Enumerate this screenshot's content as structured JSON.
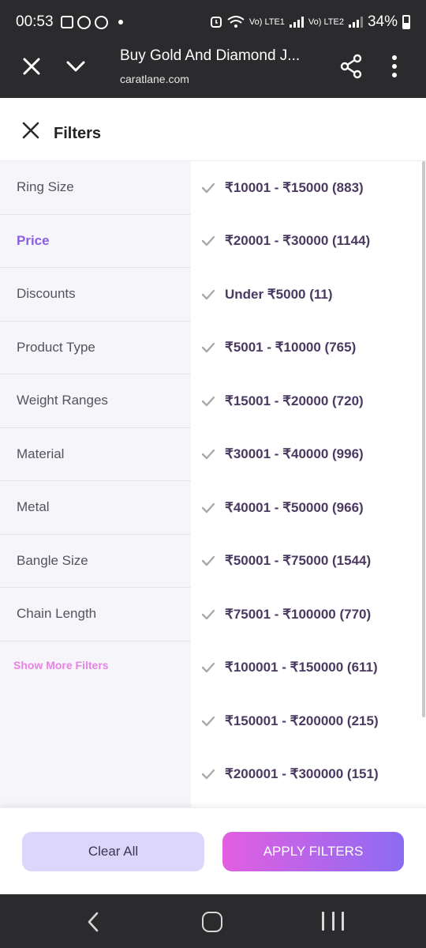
{
  "status_bar": {
    "time": "00:53",
    "network_lte1": "Vo) LTE1",
    "network_lte2": "Vo) LTE2",
    "battery": "34%",
    "icons": [
      "gallery-icon",
      "whatsapp-icon",
      "whatsapp-icon",
      "notification-dot",
      "alarm-icon",
      "wifi-icon",
      "signal-icon",
      "signal-icon",
      "battery-icon"
    ]
  },
  "browser": {
    "title": "Buy Gold And Diamond J...",
    "url": "caratlane.com",
    "icons": [
      "close-icon",
      "chevron-down-icon",
      "share-icon",
      "more-vertical-icon"
    ]
  },
  "filters": {
    "title": "Filters",
    "categories": [
      {
        "label": "Ring Size",
        "active": false
      },
      {
        "label": "Price",
        "active": true
      },
      {
        "label": "Discounts",
        "active": false
      },
      {
        "label": "Product Type",
        "active": false
      },
      {
        "label": "Weight Ranges",
        "active": false
      },
      {
        "label": "Material",
        "active": false
      },
      {
        "label": "Metal",
        "active": false
      },
      {
        "label": "Bangle Size",
        "active": false
      },
      {
        "label": "Chain Length",
        "active": false
      }
    ],
    "show_more": "Show More Filters",
    "options": [
      {
        "label": "₹10001 - ₹15000 (883)"
      },
      {
        "label": "₹20001 - ₹30000 (1144)"
      },
      {
        "label": "Under ₹5000 (11)"
      },
      {
        "label": "₹5001 - ₹10000 (765)"
      },
      {
        "label": "₹15001 - ₹20000 (720)"
      },
      {
        "label": "₹30001 - ₹40000 (996)"
      },
      {
        "label": "₹40001 - ₹50000 (966)"
      },
      {
        "label": "₹50001 - ₹75000 (1544)"
      },
      {
        "label": "₹75001 - ₹100000 (770)"
      },
      {
        "label": "₹100001 - ₹150000 (611)"
      },
      {
        "label": "₹150001 - ₹200000 (215)"
      },
      {
        "label": "₹200001 - ₹300000 (151)"
      }
    ]
  },
  "actions": {
    "clear_label": "Clear All",
    "apply_label": "APPLY FILTERS"
  },
  "colors": {
    "active_category": "#8a5fe0",
    "show_more": "#e883e6",
    "option_text": "#4a3a62",
    "clear_bg": "#dcd6fb",
    "apply_gradient_start": "#e25fe0",
    "apply_gradient_end": "#8b6cf3",
    "system_bar": "#2b2b2e"
  }
}
